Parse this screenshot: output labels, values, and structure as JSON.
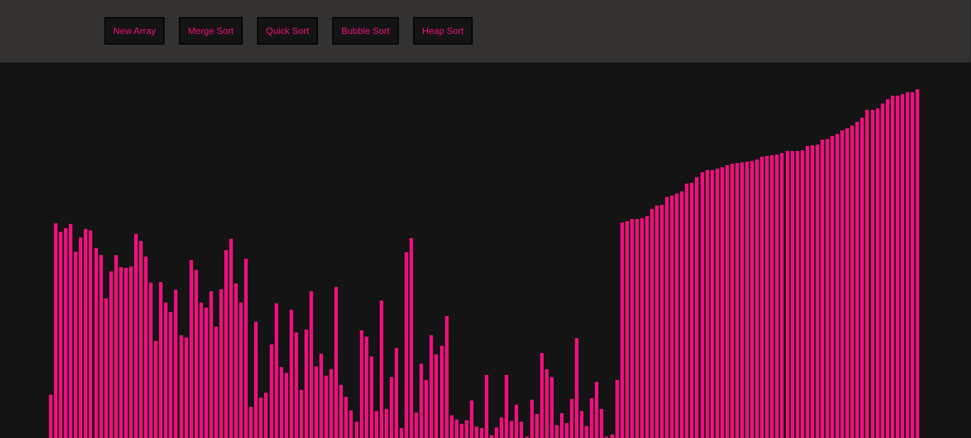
{
  "navbar": {
    "buttons": [
      {
        "id": "new-array",
        "label": "New Array"
      },
      {
        "id": "merge-sort",
        "label": "Merge Sort"
      },
      {
        "id": "quick-sort",
        "label": "Quick Sort"
      },
      {
        "id": "bubble-sort",
        "label": "Bubble Sort"
      },
      {
        "id": "heap-sort",
        "label": "Heap Sort"
      }
    ]
  },
  "theme": {
    "bar_color": "#f00e7f",
    "button_text_color": "#f0107f",
    "navbar_bg": "#333231",
    "canvas_bg": "#141414"
  },
  "array": {
    "max_value": 530,
    "values": [
      61,
      303,
      291,
      296,
      302,
      263,
      283,
      295,
      293,
      268,
      258,
      197,
      235,
      258,
      241,
      240,
      242,
      288,
      278,
      256,
      219,
      137,
      220,
      191,
      178,
      209,
      145,
      142,
      251,
      237,
      191,
      184,
      207,
      157,
      210,
      265,
      281,
      218,
      191,
      253,
      44,
      164,
      57,
      64,
      132,
      190,
      100,
      92,
      181,
      149,
      68,
      153,
      207,
      101,
      119,
      88,
      97,
      213,
      75,
      58,
      39,
      23,
      152,
      143,
      115,
      38,
      194,
      41,
      86,
      127,
      14,
      262,
      282,
      36,
      105,
      82,
      145,
      118,
      130,
      172,
      32,
      26,
      20,
      25,
      53,
      16,
      14,
      89,
      4,
      15,
      29,
      89,
      24,
      47,
      23,
      2,
      54,
      34,
      120,
      97,
      86,
      18,
      35,
      21,
      55,
      141,
      38,
      17,
      56,
      79,
      41,
      2,
      5,
      82,
      304,
      306,
      309,
      309,
      310,
      313,
      323,
      328,
      329,
      340,
      342,
      345,
      348,
      359,
      360,
      368,
      375,
      378,
      378,
      380,
      382,
      385,
      387,
      388,
      389,
      390,
      391,
      393,
      397,
      398,
      399,
      400,
      402,
      405,
      405,
      405,
      406,
      412,
      413,
      414,
      421,
      422,
      426,
      429,
      434,
      437,
      441,
      446,
      452,
      463,
      463,
      465,
      472,
      478,
      483,
      483,
      485,
      488,
      488,
      492
    ],
    "processing_index": -1
  }
}
